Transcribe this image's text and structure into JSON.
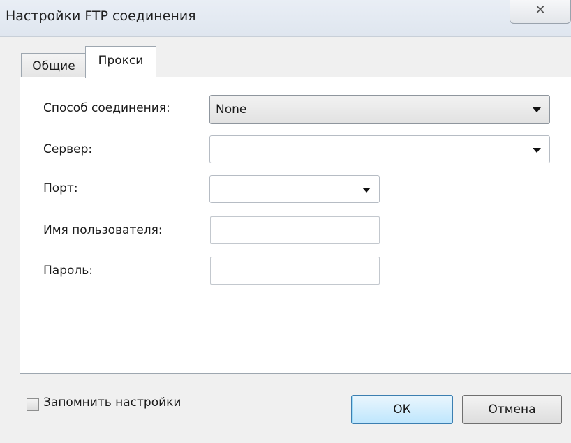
{
  "window": {
    "title": "Настройки FTP соединения",
    "close_glyph": "✕"
  },
  "tabs": [
    {
      "label": "Общие",
      "active": false
    },
    {
      "label": "Прокси",
      "active": true
    }
  ],
  "form": {
    "connection_method": {
      "label": "Способ соединения:",
      "value": "None"
    },
    "server": {
      "label": "Сервер:",
      "value": ""
    },
    "port": {
      "label": "Порт:",
      "value": ""
    },
    "username": {
      "label": "Имя пользователя:",
      "value": ""
    },
    "password": {
      "label": "Пароль:",
      "value": ""
    }
  },
  "footer": {
    "remember_label": "Запомнить настройки",
    "remember_checked": false,
    "ok_label": "ОК",
    "cancel_label": "Отмена"
  },
  "colors": {
    "default_button_border": "#3c7fb1",
    "panel_background": "#ffffff",
    "window_background": "#f0f0f0"
  }
}
